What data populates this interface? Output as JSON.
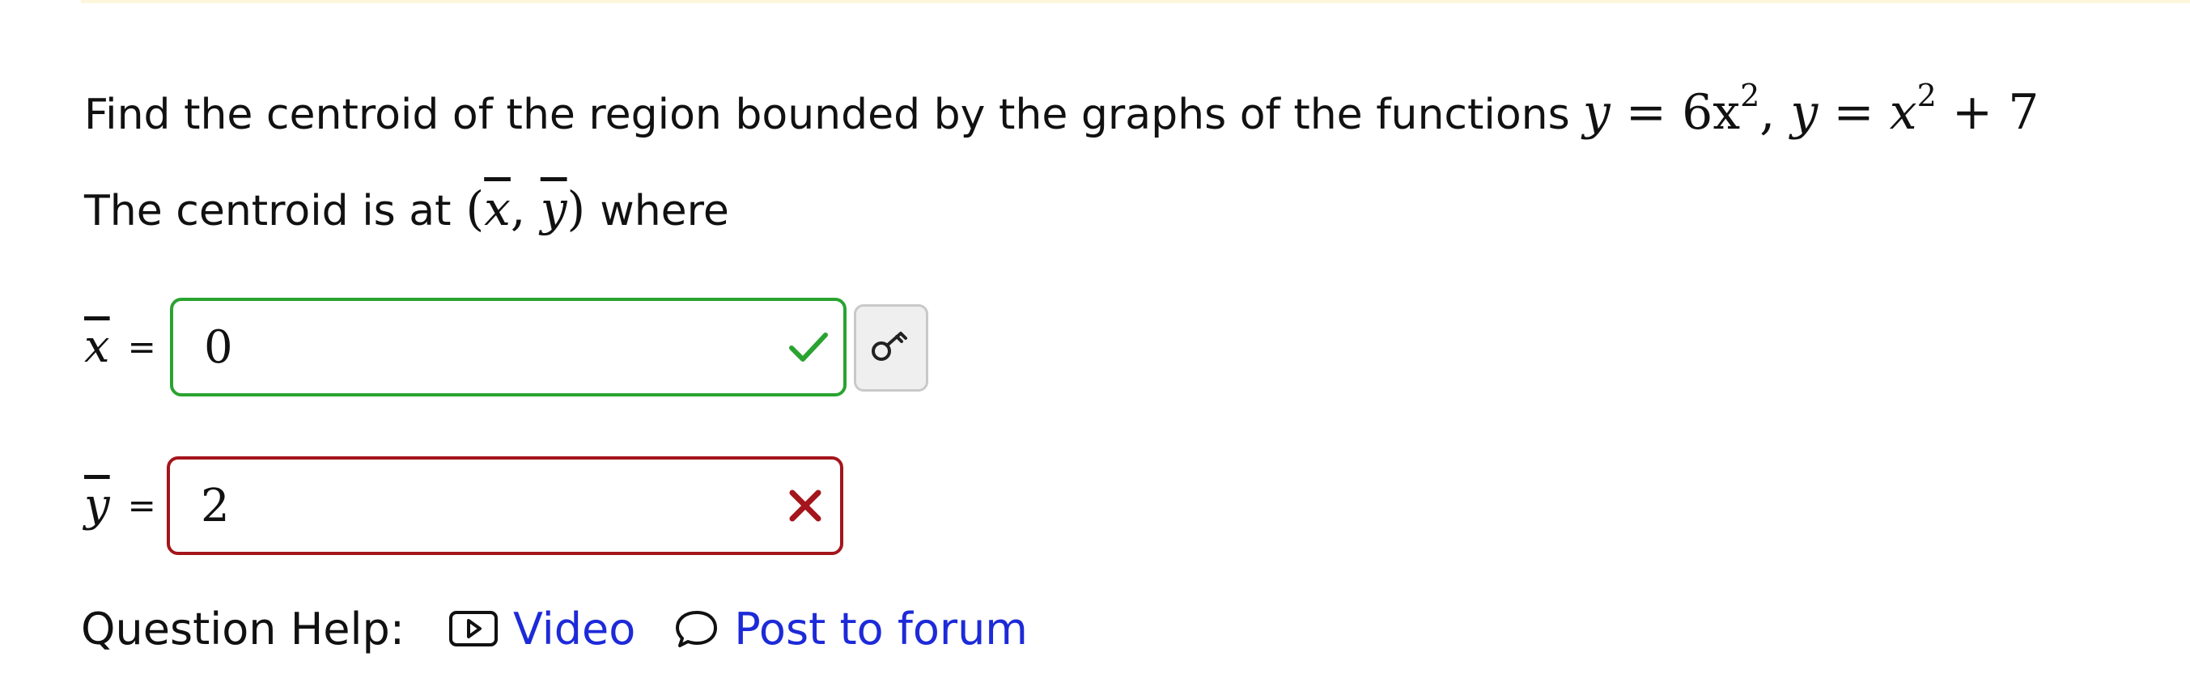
{
  "problem": {
    "prefix": "Find the centroid of the region bounded by the graphs of the functions",
    "function1_lhs": "y",
    "function1_rhs": "6x",
    "function1_exp": "2",
    "separator": ",",
    "function2_lhs": "y",
    "function2_rhs": "x",
    "function2_exp": "2",
    "function2_tail": "+ 7"
  },
  "centroid_text": {
    "prefix": "The centroid is at",
    "x_bar": "x",
    "y_bar": "y",
    "suffix": "where"
  },
  "answers": {
    "x": {
      "label": "x",
      "equals": "=",
      "value": "0",
      "status": "correct"
    },
    "y": {
      "label": "y",
      "equals": "=",
      "value": "2",
      "status": "incorrect"
    }
  },
  "help": {
    "label": "Question Help:",
    "video_label": "Video",
    "forum_label": "Post to forum"
  },
  "colors": {
    "correct": "#2aa330",
    "incorrect": "#a4151c",
    "link": "#1d2ad8"
  },
  "icons": {
    "correct": "checkmark-icon",
    "incorrect": "x-mark-icon",
    "key": "key-icon",
    "video": "video-play-icon",
    "forum": "speech-bubble-icon"
  }
}
